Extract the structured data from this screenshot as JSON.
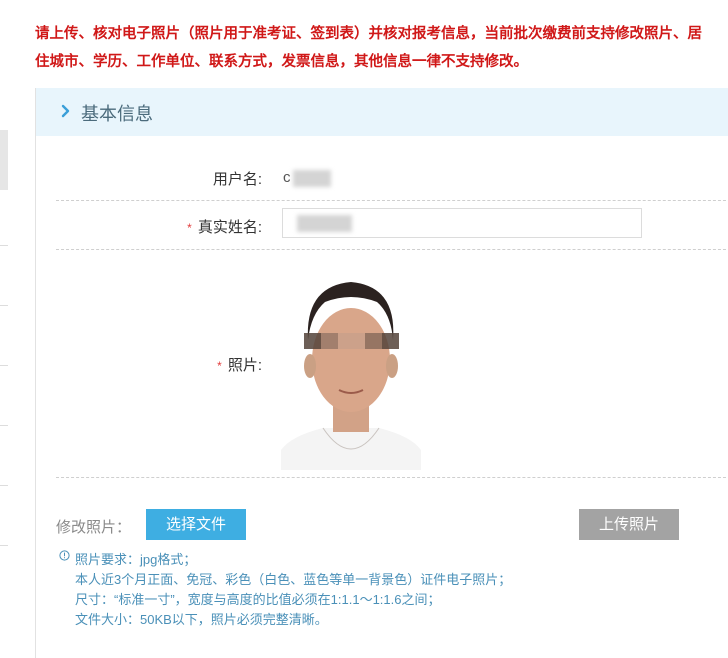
{
  "notice": {
    "line1": "请上传、核对电子照片（照片用于准考证、签到表）并核对报考信息，当前批次缴费前支持修改照片、居",
    "line2": "住城市、学历、工作单位、联系方式，发票信息，其他信息一律不支持修改。"
  },
  "section": {
    "title": "基本信息"
  },
  "form": {
    "username_label": "用户名:",
    "username_value": "c",
    "realname_label": "真实姓名:",
    "photo_label": "照片:",
    "required_mark": "*"
  },
  "upload": {
    "modify_label": "修改照片：",
    "select_button": "选择文件",
    "upload_button": "上传照片"
  },
  "requirements": [
    "照片要求：jpg格式；",
    "本人近3个月正面、免冠、彩色（白色、蓝色等单一背景色）证件电子照片；",
    "尺寸：“标准一寸”，宽度与高度的比值必须在1:1.1～1:1.6之间；",
    "文件大小：50KB以下，照片必须完整清晰。"
  ]
}
